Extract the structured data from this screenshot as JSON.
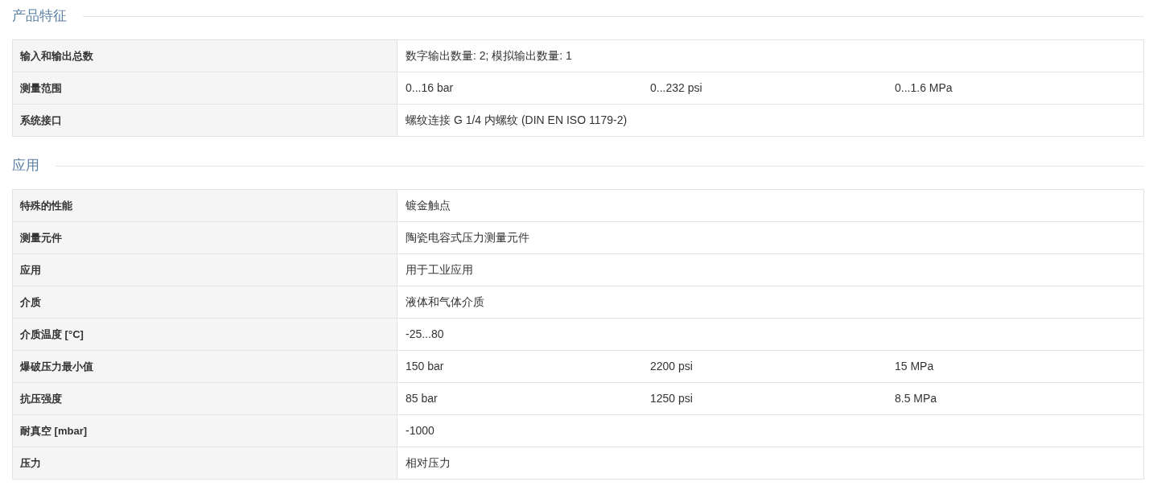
{
  "sections": [
    {
      "title": "产品特征",
      "rows": [
        {
          "label": "输入和输出总数",
          "values": [
            "数字输出数量: 2; 模拟输出数量: 1"
          ]
        },
        {
          "label": "测量范围",
          "values": [
            "0...16 bar",
            "0...232 psi",
            "0...1.6 MPa"
          ]
        },
        {
          "label": "系统接口",
          "values": [
            "螺纹连接 G 1/4 内螺纹 (DIN EN ISO 1179-2)"
          ]
        }
      ]
    },
    {
      "title": "应用",
      "rows": [
        {
          "label": "特殊的性能",
          "values": [
            "镀金触点"
          ]
        },
        {
          "label": "测量元件",
          "values": [
            "陶瓷电容式压力测量元件"
          ]
        },
        {
          "label": "应用",
          "values": [
            "用于工业应用"
          ]
        },
        {
          "label": "介质",
          "values": [
            "液体和气体介质"
          ]
        },
        {
          "label": "介质温度 [°C]",
          "values": [
            "-25...80"
          ]
        },
        {
          "label": "爆破压力最小值",
          "values": [
            "150 bar",
            "2200 psi",
            "15 MPa"
          ]
        },
        {
          "label": "抗压强度",
          "values": [
            "85 bar",
            "1250 psi",
            "8.5 MPa"
          ]
        },
        {
          "label": "耐真空 [mbar]",
          "values": [
            "-1000"
          ]
        },
        {
          "label": "压力",
          "values": [
            "相对压力"
          ]
        }
      ]
    }
  ]
}
